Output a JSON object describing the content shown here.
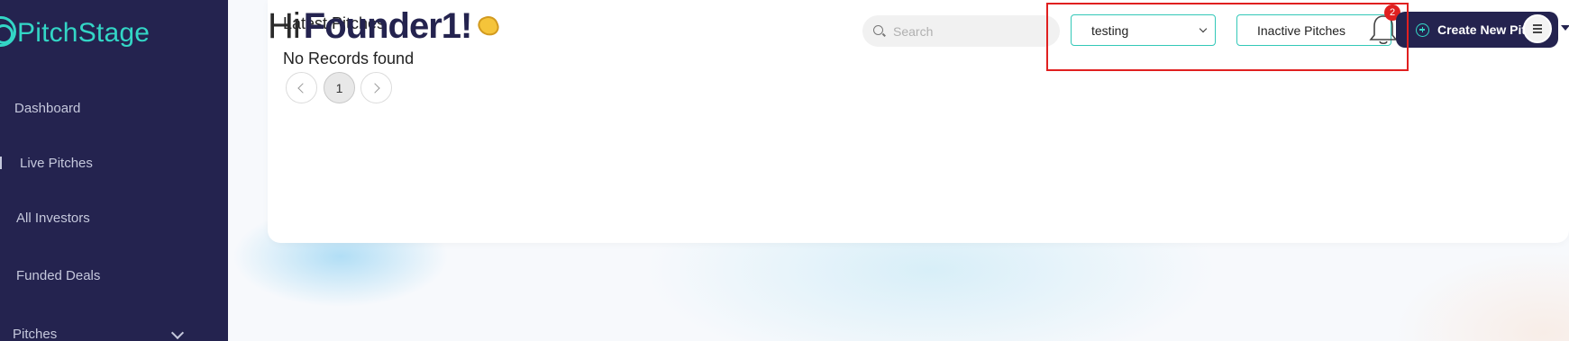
{
  "brand": {
    "name": "PitchStage"
  },
  "sidebar": {
    "items": [
      {
        "label": "Dashboard"
      },
      {
        "label": "Live Pitches"
      },
      {
        "label": "All Investors"
      },
      {
        "label": "Funded Deals"
      },
      {
        "label": "Pitches"
      }
    ]
  },
  "header": {
    "greeting_hi": "Hi",
    "greeting_name": "Founder1!",
    "search_placeholder": "Search",
    "select_value": "testing",
    "inactive_button": "Inactive Pitches",
    "notification_count": "2",
    "create_button": "Create New Pitch"
  },
  "main": {
    "section_title": "Latest Pitches",
    "empty_text": "No Records found",
    "pagination": {
      "current_page": "1"
    }
  },
  "colors": {
    "sidebar_bg": "#24234f",
    "accent": "#33d6c6",
    "highlight": "#e02020"
  }
}
